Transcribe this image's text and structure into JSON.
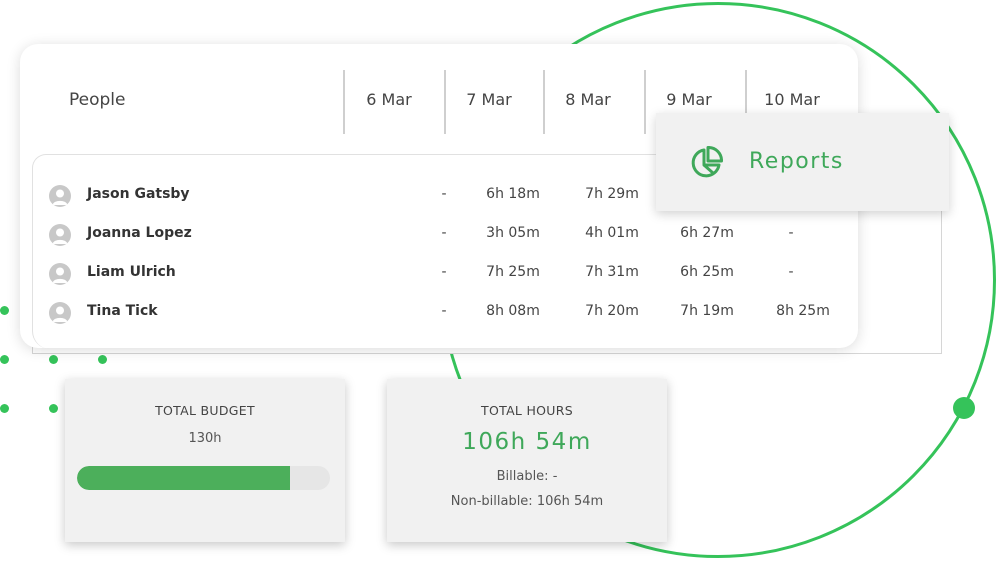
{
  "colors": {
    "accent": "#35c35a",
    "accent_text": "#3fa85a",
    "progress_fill": "#4caf5b",
    "card_bg": "#f1f1f1"
  },
  "table": {
    "people_header": "People",
    "dates": [
      "6 Mar",
      "7 Mar",
      "8 Mar",
      "9 Mar",
      "10 Mar"
    ],
    "rows": [
      {
        "name": "Jason Gatsby",
        "values": [
          "-",
          "6h 18m",
          "7h 29m",
          "",
          ""
        ]
      },
      {
        "name": "Joanna Lopez",
        "values": [
          "-",
          "3h 05m",
          "4h 01m",
          "6h 27m",
          "-"
        ]
      },
      {
        "name": "Liam Ulrich",
        "values": [
          "-",
          "7h 25m",
          "7h 31m",
          "6h 25m",
          "-"
        ]
      },
      {
        "name": "Tina Tick",
        "values": [
          "-",
          "8h 08m",
          "7h 20m",
          "7h 19m",
          "8h 25m"
        ]
      }
    ]
  },
  "reports": {
    "label": "Reports",
    "icon": "pie-chart-icon"
  },
  "budget": {
    "title": "TOTAL BUDGET",
    "value": "130h",
    "progress_fraction": 0.84
  },
  "hours": {
    "title": "TOTAL HOURS",
    "value": "106h 54m",
    "billable": "Billable: -",
    "non_billable": "Non-billable: 106h 54m"
  }
}
